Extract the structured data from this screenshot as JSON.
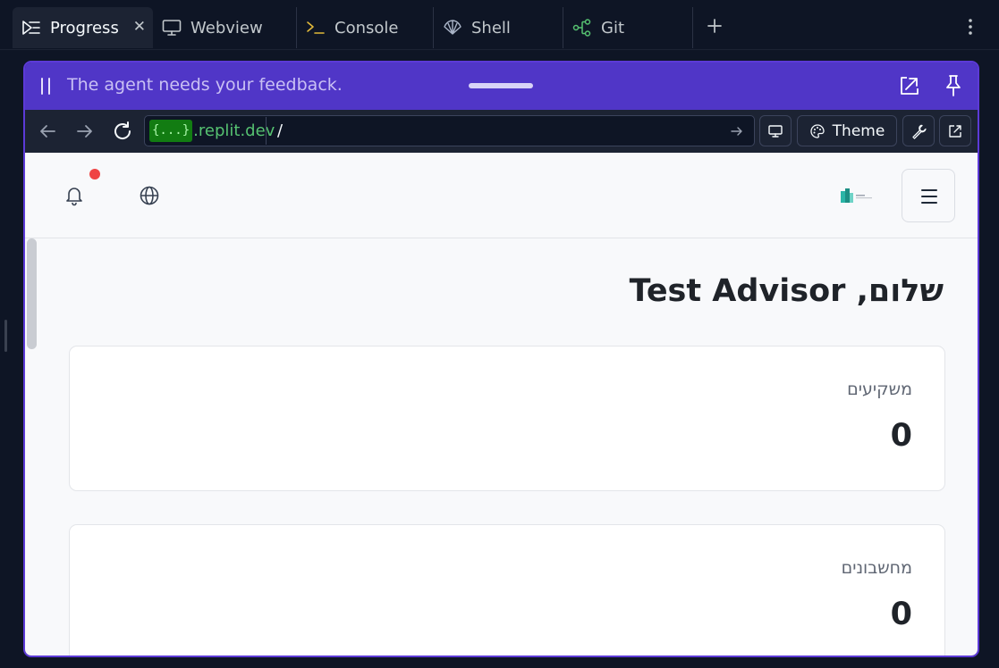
{
  "tabs": [
    {
      "label": "Progress",
      "icon": "progress-icon",
      "active": true
    },
    {
      "label": "Webview",
      "icon": "monitor-icon",
      "active": false
    },
    {
      "label": "Console",
      "icon": "console-prompt-icon",
      "active": false
    },
    {
      "label": "Shell",
      "icon": "shell-icon",
      "active": false
    },
    {
      "label": "Git",
      "icon": "git-branch-icon",
      "active": false
    }
  ],
  "feedback_banner": {
    "text": "The agent needs your feedback."
  },
  "browser": {
    "domain_placeholder": "{...}",
    "domain": ".replit.dev",
    "path": "/",
    "theme_label": "Theme"
  },
  "app": {
    "greeting": "שלום, Test Advisor",
    "has_notification": true,
    "stats": [
      {
        "label": "משקיעים",
        "value": "0"
      },
      {
        "label": "מחשבונים",
        "value": "0"
      }
    ]
  },
  "colors": {
    "accent": "#5036c7",
    "panel_border": "#5c3ad7",
    "ide_background": "#0e1525",
    "notification": "#ef4444",
    "domain_green": "#56c271"
  }
}
